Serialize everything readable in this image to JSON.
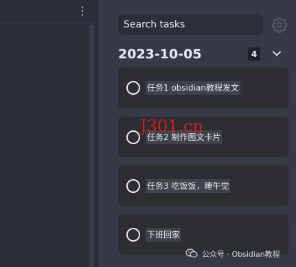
{
  "window": {
    "more_options_icon": "more-vertical-icon"
  },
  "search": {
    "placeholder": "Search tasks"
  },
  "settings_icon": "gear-icon",
  "group": {
    "date": "2023-10-05",
    "count": "4",
    "collapse_icon": "chevron-down-icon"
  },
  "tasks": [
    {
      "label": "任务1 obsidian教程发文",
      "done": false
    },
    {
      "label": "任务2 制作图文卡片",
      "done": false
    },
    {
      "label": "任务3 吃饭饭，睡午觉",
      "done": false
    },
    {
      "label": "下班回家",
      "done": false
    }
  ],
  "watermark": "J301.cn",
  "footer": {
    "text": "公众号 · Obsidian教程",
    "icon": "wechat-icon"
  },
  "colors": {
    "background": "#363a48",
    "left_pane": "#2b2e39",
    "card": "#2d2e31",
    "watermark": "#e21a1a"
  }
}
